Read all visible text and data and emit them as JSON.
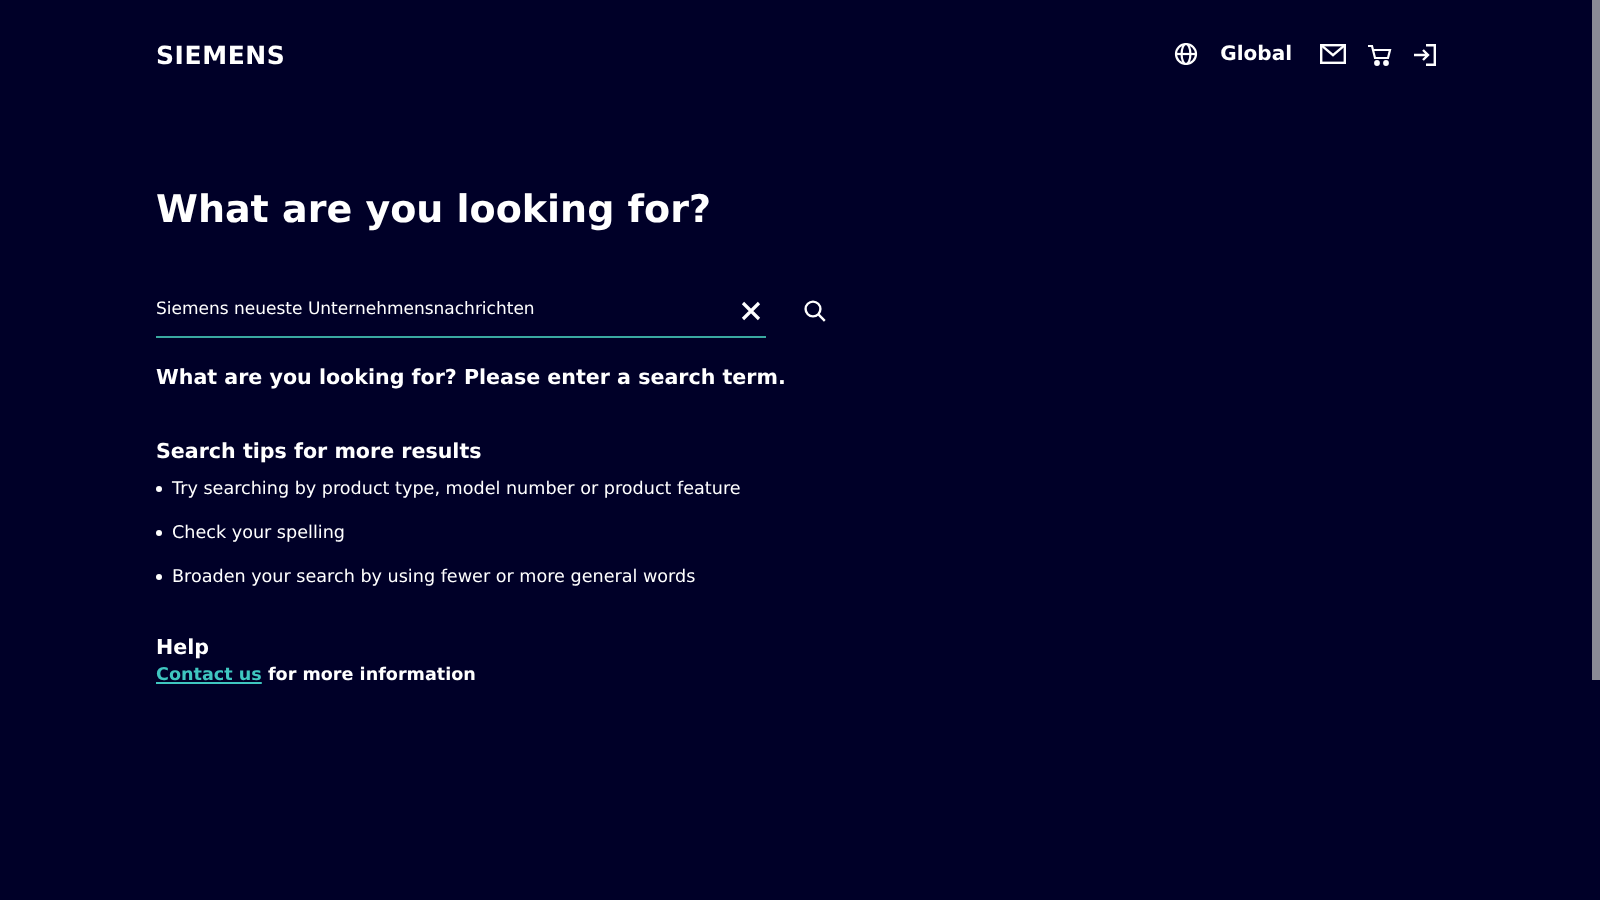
{
  "header": {
    "logo": "SIEMENS",
    "region": "Global"
  },
  "heading": "What are you looking for?",
  "search": {
    "value": "Siemens neueste Unternehmensnachrichten"
  },
  "message": "What are you looking for? Please enter a search term.",
  "tips": {
    "title": "Search tips for more results",
    "items": [
      "Try searching by product type, model number or product feature",
      "Check your spelling",
      "Broaden your search by using fewer or more general words"
    ]
  },
  "help": {
    "title": "Help",
    "link": "Contact us",
    "text": "for more information"
  }
}
